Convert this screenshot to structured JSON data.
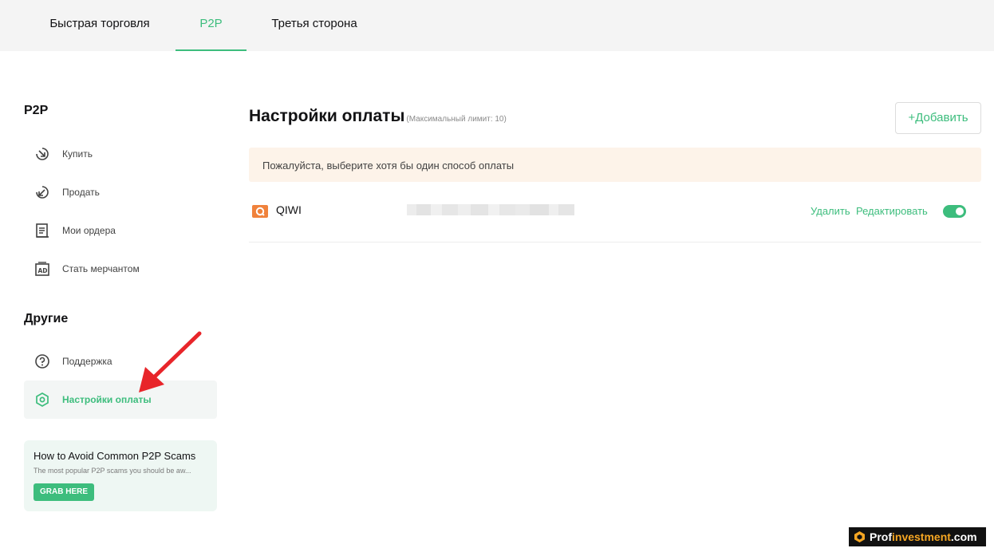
{
  "top_tabs": [
    {
      "label": "Быстрая торговля",
      "active": false
    },
    {
      "label": "P2P",
      "active": true
    },
    {
      "label": "Третья сторона",
      "active": false
    }
  ],
  "sidebar": {
    "p2p_heading": "P2P",
    "p2p_items": [
      {
        "label": "Купить",
        "icon": "buy-icon"
      },
      {
        "label": "Продать",
        "icon": "sell-icon"
      },
      {
        "label": "Мои ордера",
        "icon": "orders-icon"
      },
      {
        "label": "Стать мерчантом",
        "icon": "ad-merchant-icon"
      }
    ],
    "other_heading": "Другие",
    "other_items": [
      {
        "label": "Поддержка",
        "icon": "support-icon"
      },
      {
        "label": "Настройки оплаты",
        "icon": "payment-settings-icon",
        "active": true
      }
    ]
  },
  "promo": {
    "title": "How to Avoid Common P2P Scams",
    "subtitle": "The most popular P2P scams you should be aw...",
    "button": "GRAB HERE"
  },
  "main": {
    "title": "Настройки оплаты",
    "limit_note": "(Максимальный лимит: 10)",
    "add_button": "+Добавить",
    "notice": "Пожалуйста, выберите хотя бы один способ оплаты",
    "payment_methods": [
      {
        "name": "QIWI",
        "delete_label": "Удалить",
        "edit_label": "Редактировать",
        "enabled": true
      }
    ]
  },
  "watermark": {
    "prefix": "Prof",
    "accent": "investment",
    "suffix": ".com"
  },
  "colors": {
    "accent": "#3dbd7d",
    "notice_bg": "#fdf3e9",
    "qiwi": "#f0823c",
    "arrow": "#e8252a"
  }
}
